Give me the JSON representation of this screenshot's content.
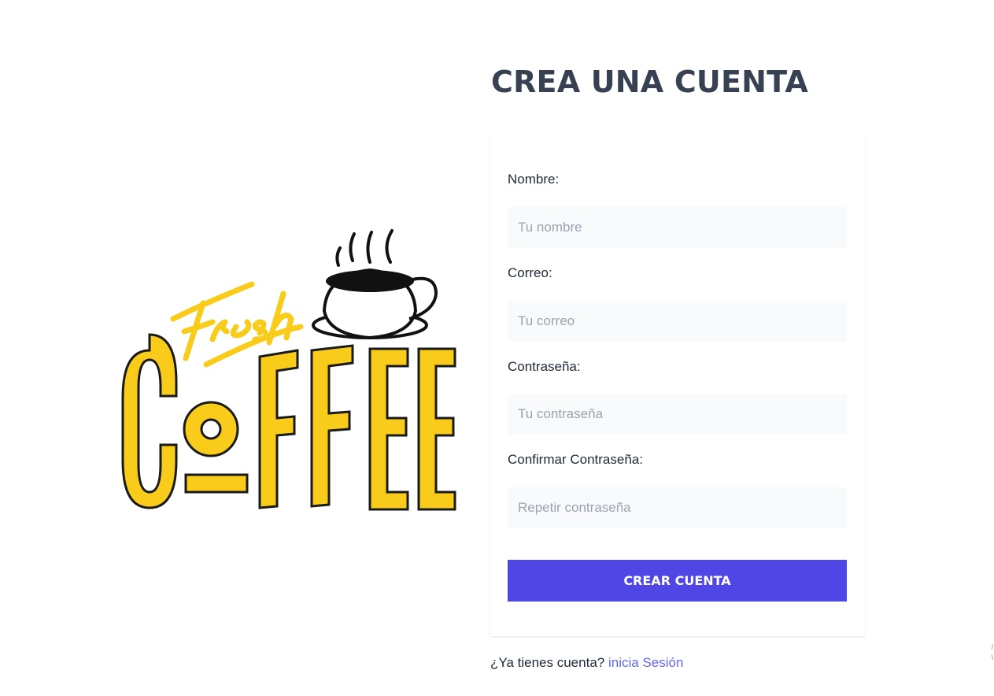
{
  "logo": {
    "word_script": "Fresh",
    "word_main": "COFFEE",
    "colors": {
      "yellow": "#f9cb1a",
      "outline": "#1a1a1a",
      "coffee": "#111111"
    }
  },
  "page": {
    "title": "CREA UNA CUENTA"
  },
  "form": {
    "name_label": "Nombre:",
    "name_placeholder": "Tu nombre",
    "email_label": "Correo:",
    "email_placeholder": "Tu correo",
    "password_label": "Contraseña:",
    "password_placeholder": "Tu contraseña",
    "confirm_label": "Confirmar Contraseña:",
    "confirm_placeholder": "Repetir contraseña",
    "submit_label": "CREAR CUENTA"
  },
  "footer": {
    "question": "¿Ya tienes cuenta?",
    "login_link": "inicia Sesión"
  },
  "colors": {
    "title": "#374151",
    "primary_button": "#4f46e5",
    "link": "#6366f1",
    "input_bg": "#f9fafb"
  }
}
